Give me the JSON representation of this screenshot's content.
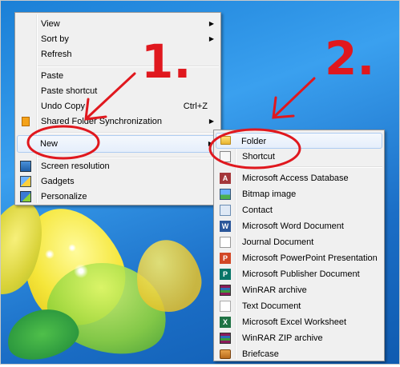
{
  "context_menu": {
    "items": [
      {
        "label": "View",
        "submenu": true
      },
      {
        "label": "Sort by",
        "submenu": true
      },
      {
        "label": "Refresh"
      },
      {
        "label": "Paste"
      },
      {
        "label": "Paste shortcut"
      },
      {
        "label": "Undo Copy",
        "shortcut": "Ctrl+Z"
      },
      {
        "label": "Shared Folder Synchronization",
        "submenu": true,
        "icon": "sync-icon"
      },
      {
        "label": "New",
        "submenu": true,
        "highlighted": true
      },
      {
        "label": "Screen resolution",
        "icon": "display-icon"
      },
      {
        "label": "Gadgets",
        "icon": "gadgets-icon"
      },
      {
        "label": "Personalize",
        "icon": "personalize-icon"
      }
    ]
  },
  "new_submenu": {
    "items": [
      {
        "label": "Folder",
        "icon": "folder-icon",
        "highlighted": true
      },
      {
        "label": "Shortcut",
        "icon": "shortcut-icon"
      },
      {
        "label": "Microsoft Access Database",
        "icon": "access-icon"
      },
      {
        "label": "Bitmap image",
        "icon": "bitmap-icon"
      },
      {
        "label": "Contact",
        "icon": "contact-icon"
      },
      {
        "label": "Microsoft Word Document",
        "icon": "word-icon"
      },
      {
        "label": "Journal Document",
        "icon": "journal-icon"
      },
      {
        "label": "Microsoft PowerPoint Presentation",
        "icon": "powerpoint-icon"
      },
      {
        "label": "Microsoft Publisher Document",
        "icon": "publisher-icon"
      },
      {
        "label": "WinRAR archive",
        "icon": "winrar-icon"
      },
      {
        "label": "Text Document",
        "icon": "text-document-icon"
      },
      {
        "label": "Microsoft Excel Worksheet",
        "icon": "excel-icon"
      },
      {
        "label": "WinRAR ZIP archive",
        "icon": "winrar-zip-icon"
      },
      {
        "label": "Briefcase",
        "icon": "briefcase-icon"
      }
    ]
  },
  "annotations": {
    "step1": "1.",
    "step2": "2.",
    "color": "#e0181e"
  }
}
